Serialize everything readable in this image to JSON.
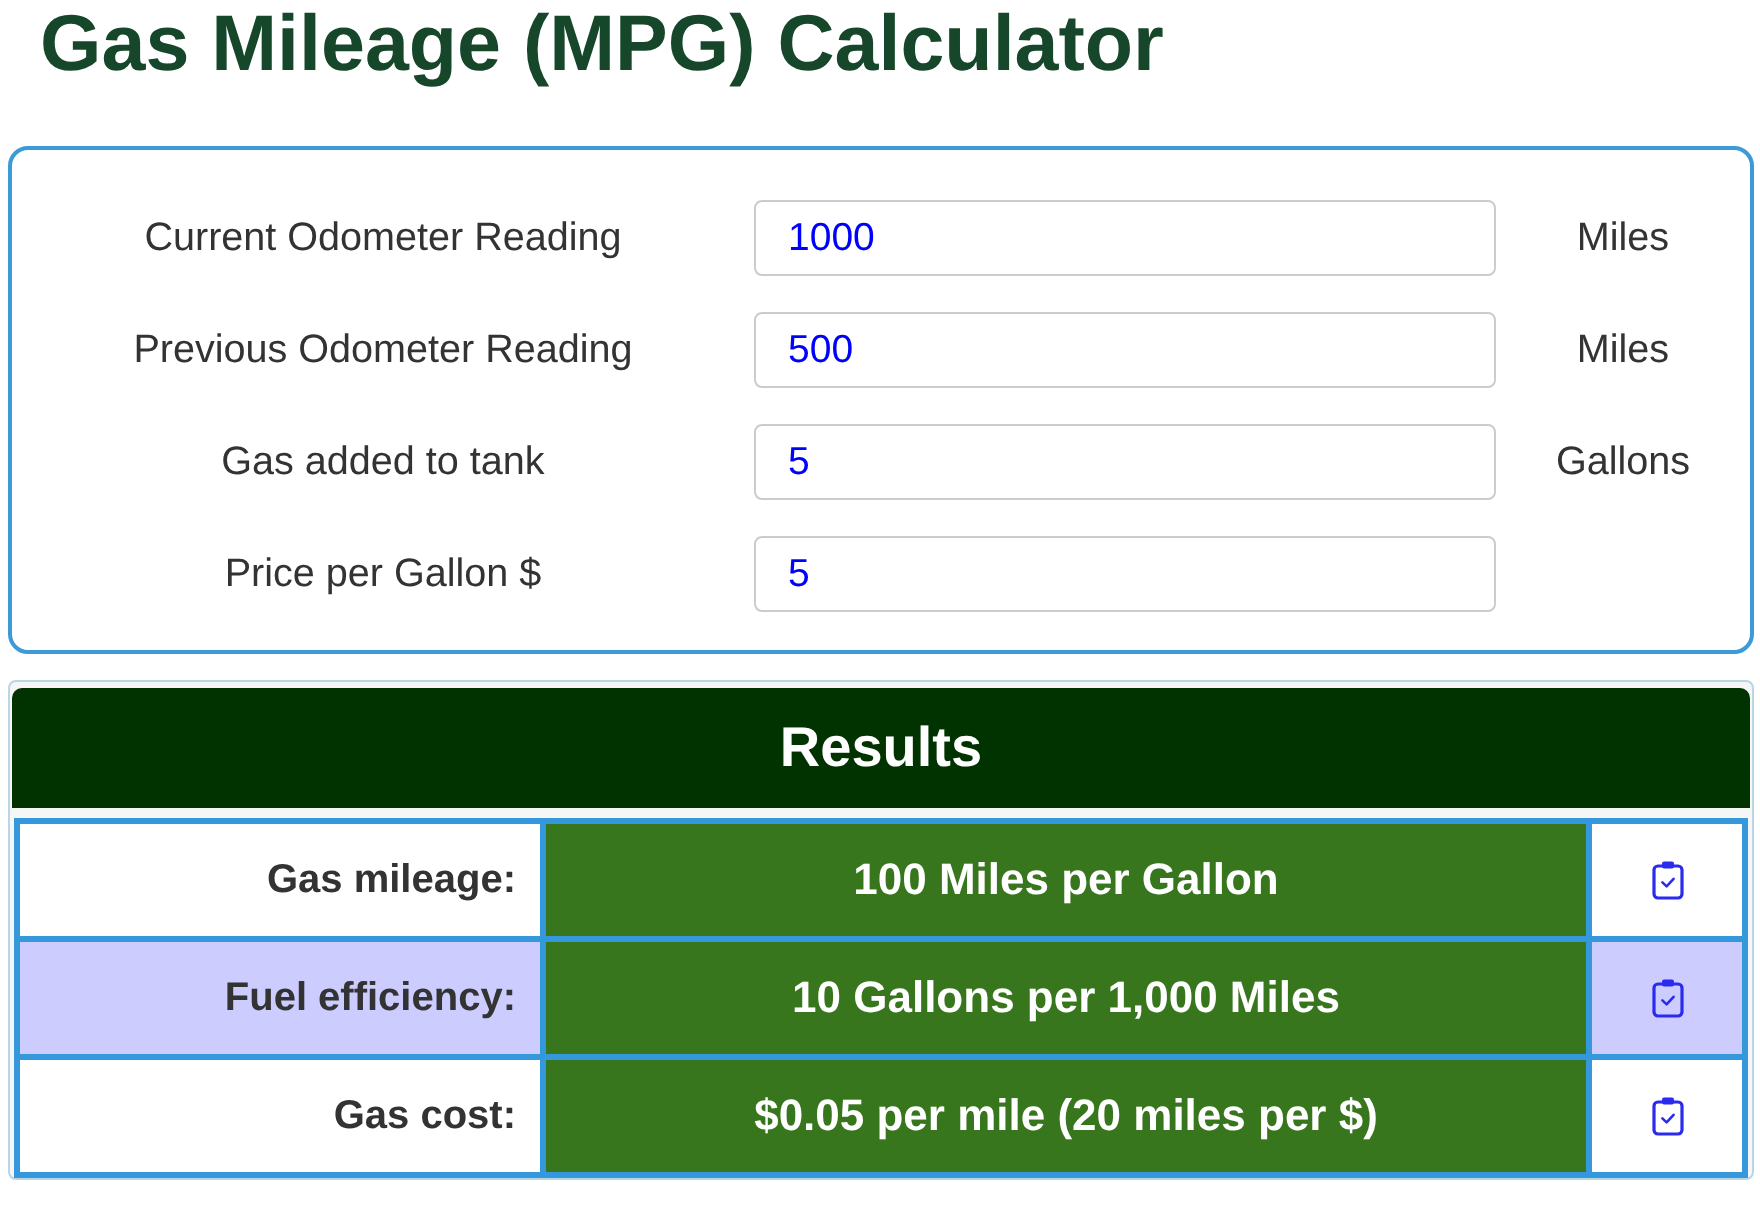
{
  "title": "Gas Mileage (MPG) Calculator",
  "inputs": [
    {
      "label": "Current Odometer Reading",
      "value": "1000",
      "unit": "Miles"
    },
    {
      "label": "Previous Odometer Reading",
      "value": "500",
      "unit": "Miles"
    },
    {
      "label": "Gas added to tank",
      "value": "5",
      "unit": "Gallons"
    },
    {
      "label": "Price per Gallon $",
      "value": "5"
    }
  ],
  "results": {
    "title": "Results",
    "rows": [
      {
        "label": "Gas mileage:",
        "value": "100 Miles per Gallon"
      },
      {
        "label": "Fuel efficiency:",
        "value": "10 Gallons per 1,000 Miles"
      },
      {
        "label": "Gas cost:",
        "value": "$0.05 per mile (20 miles per $)"
      }
    ]
  }
}
